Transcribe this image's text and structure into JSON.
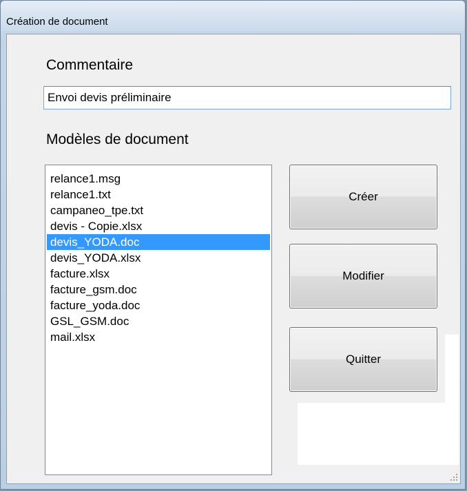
{
  "window": {
    "title": "Création de document"
  },
  "comment": {
    "label": "Commentaire",
    "value": "Envoi devis préliminaire"
  },
  "templates": {
    "label": "Modèles de document",
    "items": [
      "relance1.msg",
      "relance1.txt",
      "campaneo_tpe.txt",
      "devis - Copie.xlsx",
      "devis_YODA.doc",
      "devis_YODA.xlsx",
      "facture.xlsx",
      "facture_gsm.doc",
      "facture_yoda.doc",
      "GSL_GSM.doc",
      "mail.xlsx"
    ],
    "selected_index": 4
  },
  "buttons": {
    "create": "Créer",
    "modify": "Modifier",
    "quit": "Quitter"
  },
  "colors": {
    "selection": "#3399ff",
    "client_background": "#f0f0f0"
  }
}
